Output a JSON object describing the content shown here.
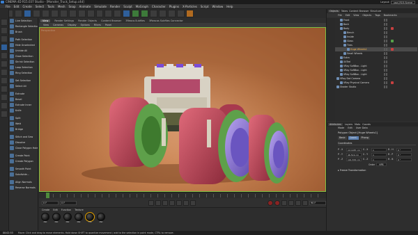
{
  "app": {
    "title": "CINEMA 4D R15.037 Studio - [Monster_Truck_Setup.c4d]"
  },
  "layout": {
    "label": "Layout:",
    "value": "psd_R15.Scene"
  },
  "menubar": [
    "File",
    "Edit",
    "Create",
    "Select",
    "Tools",
    "Mesh",
    "Snap",
    "Animate",
    "Simulate",
    "Render",
    "Sculpt",
    "MoGraph",
    "Character",
    "Plugins",
    "X-Particles",
    "Script",
    "Window",
    "Help"
  ],
  "left_commands": [
    "Live Selection",
    "Rectangle Selection",
    "Brush",
    "",
    "Path Selection",
    "Hide Unselected",
    "Unhide All",
    "Grow Selection",
    "Shrink Selection",
    "Loop Selection",
    "Ring Selection",
    "",
    "Set Selection",
    "Select All",
    "",
    "Extrude",
    "Bevel",
    "Extrude Inner",
    "Knife",
    "",
    "Split",
    "Weld",
    "Bridge",
    "",
    "Stitch and Sew",
    "Dissolve",
    "Close Polygon Hole",
    "",
    "Create Point",
    "Create Polygon",
    "",
    "Smooth Point",
    "Subdivide...",
    "",
    "Align Normals",
    "Reverse Normals"
  ],
  "viewport": {
    "tabs": [
      "View",
      "Render Settings",
      "Render Objects",
      "Content Browser",
      "3Reaco.Subfiles",
      "3Reacos Subfiles Connector"
    ],
    "active_tab": "View",
    "menu": [
      "View",
      "Cameras",
      "Display",
      "Options",
      "Filters",
      "Panel"
    ],
    "label": "Perspective"
  },
  "timeline": {
    "start": "0 F",
    "end": "90 F",
    "current": "0 F"
  },
  "material_manager": {
    "menu": [
      "Create",
      "Edit",
      "Function",
      "Texture"
    ],
    "materials": [
      {
        "label": "Mat"
      },
      {
        "label": "Mat"
      },
      {
        "label": "Mat"
      },
      {
        "label": "Mat"
      },
      {
        "label": "Tire",
        "selected": true
      },
      {
        "label": "Mat"
      }
    ]
  },
  "object_manager": {
    "tabs": [
      "Objects",
      "Takes",
      "Content Browser",
      "Structure"
    ],
    "active_tab": "Objects",
    "menu": [
      "File",
      "Edit",
      "View",
      "Objects",
      "Tags",
      "Bookmarks"
    ],
    "items": [
      {
        "name": "Front",
        "indent": 1,
        "tag": "none"
      },
      {
        "name": "Back",
        "indent": 1,
        "tag": "none"
      },
      {
        "name": "Body",
        "indent": 1,
        "tag": "r"
      },
      {
        "name": "Bench",
        "indent": 2,
        "tag": "none"
      },
      {
        "name": "Inside",
        "indent": 2,
        "tag": "none"
      },
      {
        "name": "Glass",
        "indent": 2,
        "tag": "g"
      },
      {
        "name": "Tires",
        "indent": 2,
        "tag": "none"
      },
      {
        "name": "Huge Wheels1",
        "indent": 3,
        "tag": "r",
        "selected": true
      },
      {
        "name": "Small Wheels",
        "indent": 2,
        "tag": "none"
      },
      {
        "name": "Extra",
        "indent": 1,
        "tag": "none"
      },
      {
        "name": "XXTrel",
        "indent": 1,
        "tag": "none"
      },
      {
        "name": "VRay SoftBox - Light",
        "indent": 1,
        "tag": "none"
      },
      {
        "name": "VRay SoftBox - Light",
        "indent": 1,
        "tag": "none"
      },
      {
        "name": "VRay SoftBox - Light",
        "indent": 1,
        "tag": "none"
      },
      {
        "name": "VRay Dot Camera",
        "indent": 0,
        "tag": "none"
      },
      {
        "name": "VRay Physical Camera",
        "indent": 1,
        "tag": "r"
      },
      {
        "name": "Shader Studio",
        "indent": 0,
        "tag": "none"
      }
    ]
  },
  "attributes": {
    "tabs": [
      "Attributes",
      "Layers",
      "Mats",
      "Coords"
    ],
    "active_tab": "Attributes",
    "menu": [
      "Mode",
      "Edit",
      "User Data"
    ],
    "title": "Polygon Object [Huge Wheels1]",
    "buttons": [
      "Basic",
      "Coord.",
      "Phong"
    ],
    "active_button": "Coord.",
    "section": "Coordinates",
    "rows": [
      {
        "a_label": "P . X",
        "a_val": "113.487 cm",
        "b_label": "S . X",
        "b_val": "1",
        "c_label": "R . H",
        "c_val": "0 °"
      },
      {
        "a_label": "P . Y",
        "a_val": "46.519 cm",
        "b_label": "S . Y",
        "b_val": "1",
        "c_label": "R . P",
        "c_val": "0 °"
      },
      {
        "a_label": "P . Z",
        "a_val": "101.553 cm",
        "b_label": "S . Z",
        "b_val": "1",
        "c_label": "R . B",
        "c_val": "0 °"
      }
    ],
    "order_label": "Order",
    "order_value": "HPB",
    "freeze": "▸ Freeze Transformation"
  },
  "status": {
    "time": "00:02:53",
    "message": "Move: Click and drag to move elements. Hold down SHIFT to quantize movement / add to the selection in point mode, CTRL to remove."
  },
  "float_label": "Layout: psd_R15"
}
